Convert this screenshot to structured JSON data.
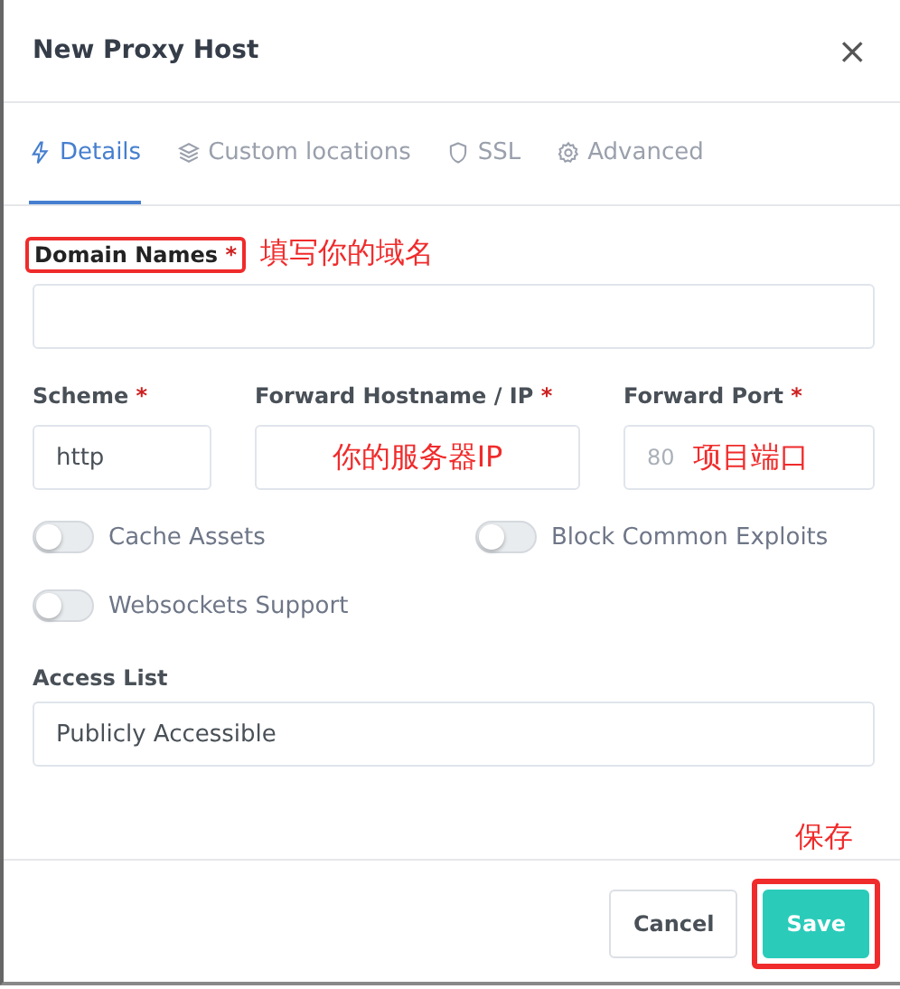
{
  "dialog": {
    "title": "New Proxy Host",
    "close": "×"
  },
  "tabs": [
    {
      "label": "Details",
      "kind": "bolt",
      "selected": true
    },
    {
      "label": "Custom locations",
      "kind": "layers",
      "selected": false
    },
    {
      "label": "SSL",
      "kind": "shield",
      "selected": false
    },
    {
      "label": "Advanced",
      "kind": "gear",
      "selected": false
    }
  ],
  "domain": {
    "label": "Domain Names",
    "required_mark": "*",
    "highlighted": true,
    "annotation": "填写你的域名"
  },
  "forward_fields": [
    {
      "label": "Scheme",
      "required_mark": "*",
      "value": "http"
    },
    {
      "label": "Forward Hostname / IP",
      "required_mark": "*",
      "annotation": "你的服务器IP"
    },
    {
      "label": "Forward Port",
      "required_mark": "*",
      "placeholder": "80",
      "annotation": "项目端口"
    }
  ],
  "toggles": [
    {
      "label": "Cache Assets",
      "on": false
    },
    {
      "label": "Block Common Exploits",
      "on": false
    },
    {
      "label": "Websockets Support",
      "on": false
    }
  ],
  "access_list": {
    "label": "Access List",
    "value": "Publicly Accessible"
  },
  "buttons": [
    {
      "label": "Cancel",
      "kind": "secondary",
      "highlighted": false
    },
    {
      "label": "Save",
      "kind": "primary",
      "highlighted": true,
      "annotation": "保存"
    }
  ]
}
